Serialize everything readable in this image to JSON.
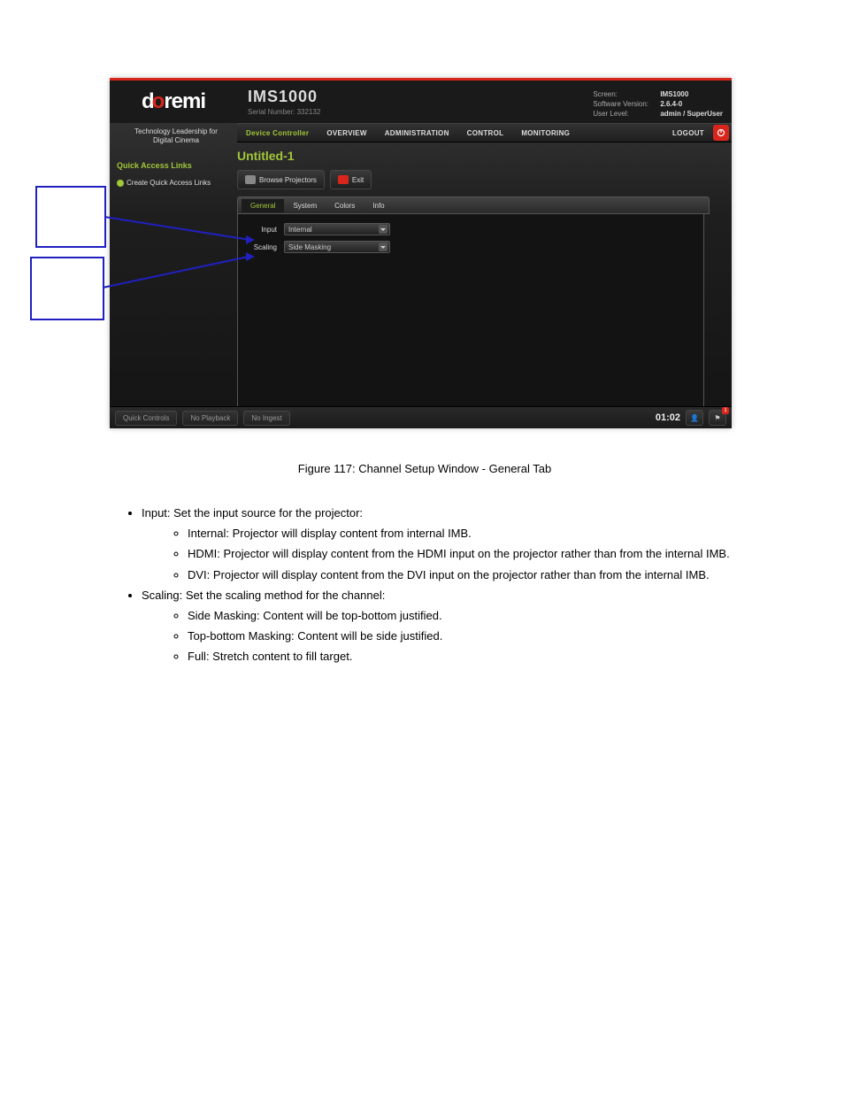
{
  "logo_text_parts": {
    "d": "d",
    "o": "o",
    "remi": "remi"
  },
  "tagline": "Technology Leadership for Digital Cinema",
  "product": {
    "title": "IMS1000",
    "serial": "Serial Number: 332132"
  },
  "meta": {
    "screen_k": "Screen:",
    "screen_v": "IMS1000",
    "ver_k": "Software Version:",
    "ver_v": "2.6.4-0",
    "lvl_k": "User Level:",
    "lvl_v": "admin / SuperUser"
  },
  "nav": {
    "device": "Device Controller",
    "overview": "OVERVIEW",
    "admin": "ADMINISTRATION",
    "control": "CONTROL",
    "monitor": "MONITORING",
    "logout": "LOGOUT"
  },
  "sidebar": {
    "title": "Quick Access Links",
    "link": "Create Quick Access Links"
  },
  "page_title": "Untitled-1",
  "toolbar": {
    "browse": "Browse Projectors",
    "exit": "Exit"
  },
  "tabs": {
    "general": "General",
    "system": "System",
    "colors": "Colors",
    "info": "Info"
  },
  "form": {
    "input_label": "Input",
    "input_value": "Internal",
    "scaling_label": "Scaling",
    "scaling_value": "Side Masking"
  },
  "footer": {
    "qc": "Quick Controls",
    "np": "No Playback",
    "ni": "No Ingest",
    "time": "01:02",
    "badge": "1"
  },
  "doc": {
    "caption": "Figure 117: Channel Setup Window - General Tab",
    "li1": "Input: Set the input source for the projector:",
    "li1a": "Internal: Projector will display content from internal IMB.",
    "li1b": "HDMI: Projector will display content from the HDMI input on the projector rather than from the internal IMB.",
    "li1c": "DVI: Projector will display content from the DVI input on the projector rather than from the internal IMB.",
    "li2": "Scaling: Set the scaling method for the channel:",
    "li2a": "Side Masking: Content will be top-bottom justified.",
    "li2b": "Top-bottom Masking: Content will be side justified.",
    "li2c": "Full: Stretch content to fill target."
  }
}
